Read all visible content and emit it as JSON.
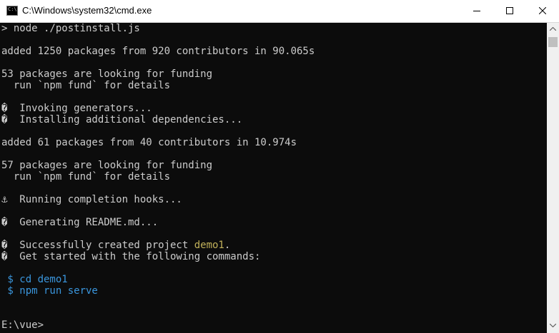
{
  "window": {
    "title": "C:\\Windows\\system32\\cmd.exe",
    "icon_text": "C:\\",
    "icons": {
      "app": "cmd-icon",
      "minimize": "minimize-icon",
      "maximize": "maximize-icon",
      "close": "close-icon"
    }
  },
  "console": {
    "lines": [
      "> node ./postinstall.js",
      "",
      "added 1250 packages from 920 contributors in 90.065s",
      "",
      "53 packages are looking for funding",
      "  run `npm fund` for details",
      "",
      "�  Invoking generators...",
      "�  Installing additional dependencies...",
      "",
      "added 61 packages from 40 contributors in 10.974s",
      "",
      "57 packages are looking for funding",
      "  run `npm fund` for details",
      "",
      "⚓  Running completion hooks...",
      "",
      "�  Generating README.md...",
      "",
      "�  Successfully created project ",
      "�  Get started with the following commands:",
      "",
      " $ cd demo1",
      " $ npm run serve",
      "",
      "",
      "E:\\vue>"
    ],
    "project_name": "demo1",
    "project_suffix": "."
  },
  "colors": {
    "background": "#0c0c0c",
    "text": "#cccccc",
    "highlight": "#c1b15a",
    "command": "#3a96dd"
  }
}
